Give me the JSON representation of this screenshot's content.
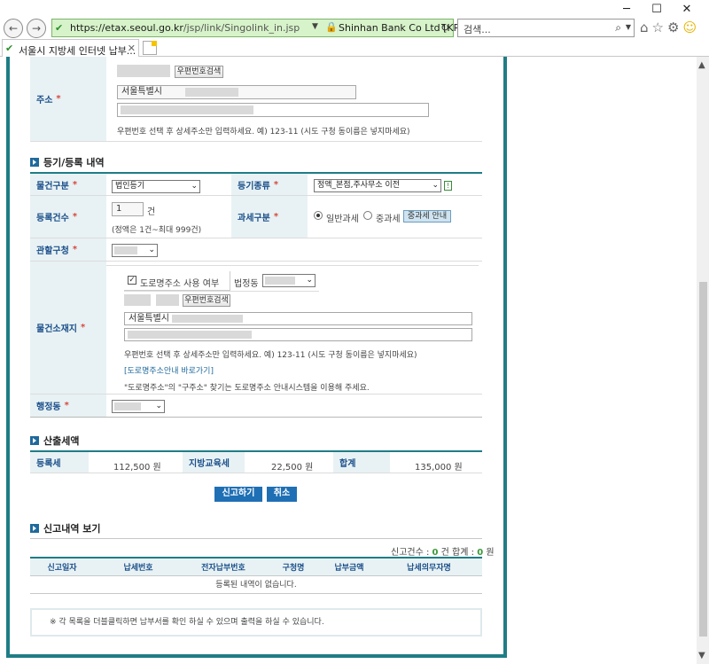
{
  "browser": {
    "url_host": "https://etax.seoul.go.kr",
    "url_path": "/jsp/link/Singolink_in.jsp",
    "cert": "Shinhan Bank Co Ltd [KR]",
    "search_placeholder": "검색...",
    "tab_title": "서울시 지방세 인터넷 납부...",
    "icons": [
      "back-icon",
      "forward-icon",
      "lock-icon",
      "refresh-icon",
      "search-icon",
      "home-icon",
      "star-icon",
      "gear-icon",
      "smiley-icon"
    ]
  },
  "address": {
    "label": "주소",
    "zip_search_btn": "우편번호검색",
    "line1": "서울특별시",
    "note": "우편번호 선택 후 상세주소만 입력하세요. 예) 123-11 (시도 구청 동이름은 넣지마세요)"
  },
  "registration": {
    "section_title": "등기/등록 내역",
    "item_type_label": "물건구분",
    "item_type_value": "법인등기",
    "reg_kind_label": "등기종류",
    "reg_kind_value": "정액_본점,주사무소 이전",
    "reg_kind_help": "!",
    "count_label": "등록건수",
    "count_value": "1",
    "count_unit": "건",
    "count_note": "(정액은 1건~최대 999건)",
    "tax_type_label": "과세구분",
    "tax_normal": "일반과세",
    "tax_heavy": "중과세",
    "tax_heavy_btn": "중과세 안내",
    "district_label": "관할구청",
    "location_label": "물건소재지",
    "road_addr_check": "도로명주소 사용 여부",
    "legal_dong_label": "법정동 :",
    "zip_search_btn": "우편번호검색",
    "loc_line1": "서울특별시",
    "loc_note": "우편번호 선택 후 상세주소만 입력하세요. 예) 123-11 (시도 구청 동이름은 넣지마세요)",
    "road_guide_link": "[도로명주소안내 바로가기]",
    "road_guide_note": "\"도로명주소\"의 \"구주소\" 찾기는 도로명주소 안내시스템을 이용해 주세요.",
    "admin_dong_label": "행정동"
  },
  "calc": {
    "section_title": "산출세액",
    "reg_tax_label": "등록세",
    "reg_tax_value": "112,500 원",
    "edu_tax_label": "지방교육세",
    "edu_tax_value": "22,500 원",
    "total_label": "합계",
    "total_value": "135,000 원"
  },
  "actions": {
    "submit": "신고하기",
    "cancel": "취소"
  },
  "history": {
    "section_title": "신고내역 보기",
    "summary_prefix": "신고건수 : ",
    "count": "0",
    "summary_mid": " 건 합계 : ",
    "total": "0",
    "summary_suffix": " 원",
    "columns": [
      "신고일자",
      "납세번호",
      "전자납부번호",
      "구청명",
      "납부금액",
      "납세의무자명"
    ],
    "empty": "등록된 내역이 없습니다.",
    "footnote": "※ 각 목록을 더블클릭하면 납부서를 확인 하실 수 있으며 출력을 하실 수 있습니다."
  }
}
